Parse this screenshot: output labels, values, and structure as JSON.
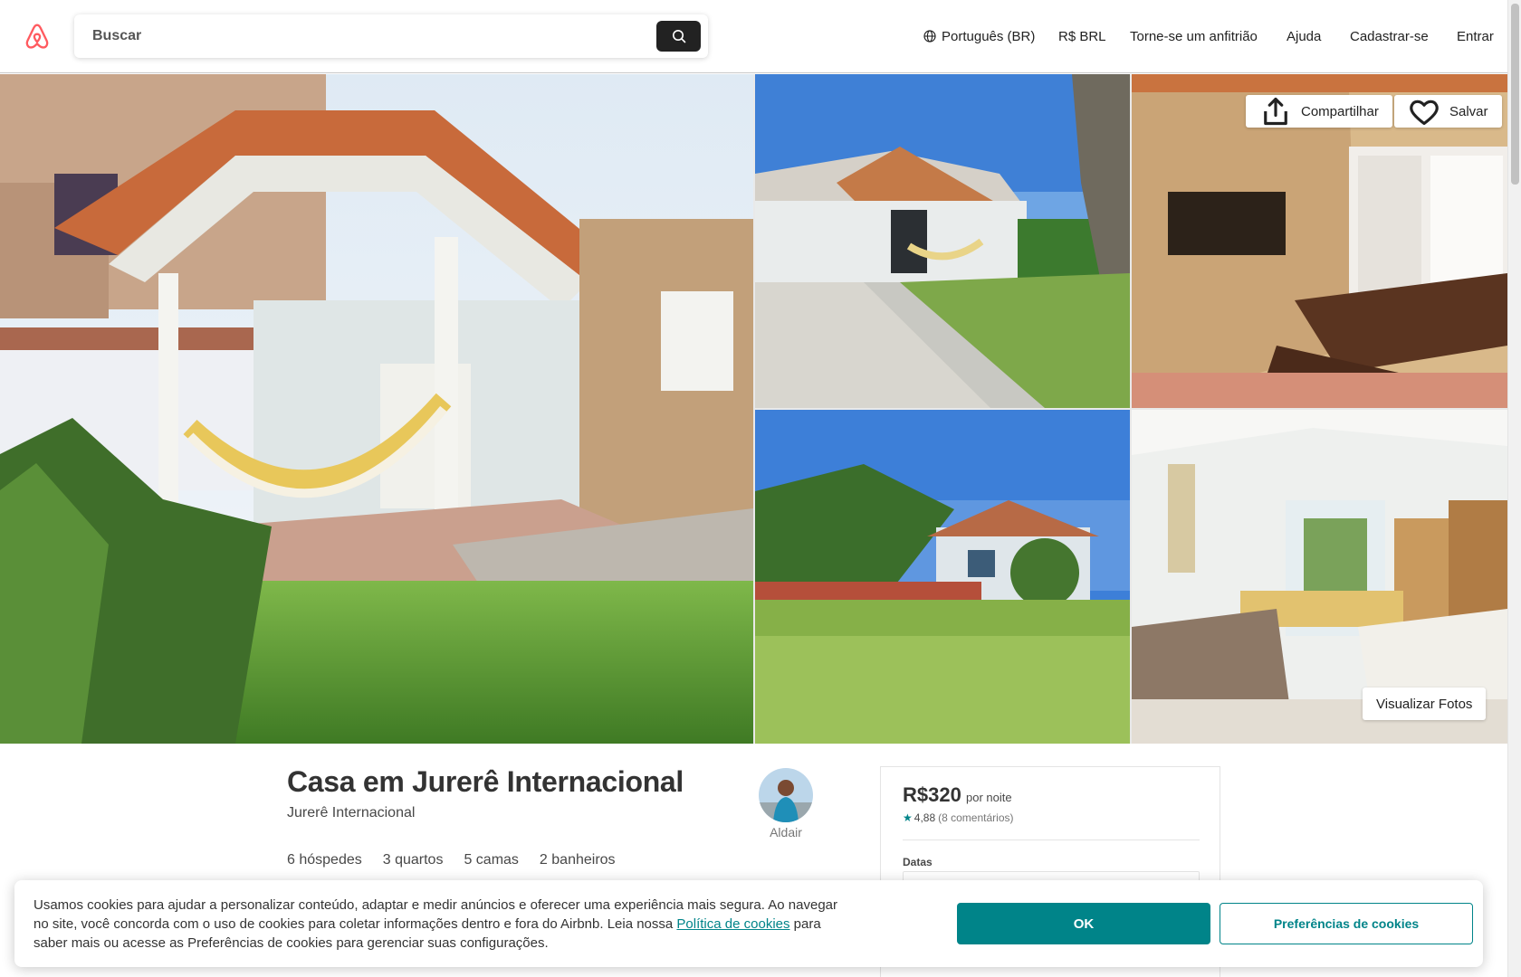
{
  "header": {
    "logo_icon": "airbnb-belo-icon",
    "search_placeholder": "Buscar",
    "search_icon": "search-icon",
    "nav": {
      "language": "Português (BR)",
      "currency": "R$ BRL",
      "host": "Torne-se um anfitrião",
      "help": "Ajuda",
      "signup": "Cadastrar-se",
      "login": "Entrar"
    }
  },
  "photos": {
    "share_label": "Compartilhar",
    "save_label": "Salvar",
    "view_photos_label": "Visualizar Fotos"
  },
  "listing": {
    "title": "Casa em Jurerê Internacional",
    "location": "Jurerê Internacional",
    "host_name": "Aldair",
    "facts": {
      "guests": "6 hóspedes",
      "bedrooms": "3 quartos",
      "beds": "5 camas",
      "bathrooms": "2 banheiros"
    }
  },
  "booking": {
    "price": "R$320",
    "per_night": "por noite",
    "rating": "4,88",
    "reviews": "(8 comentários)",
    "dates_label": "Datas"
  },
  "cookie_banner": {
    "text_before_link": "Usamos cookies para ajudar a personalizar conteúdo, adaptar e medir anúncios e oferecer uma experiência mais segura. Ao navegar no site, você concorda com o uso de cookies para coletar informações dentro e fora do Airbnb. Leia nossa ",
    "link_label": "Política de cookies",
    "text_after_link": " para saber mais ou acesse as Preferências de cookies para gerenciar suas configurações.",
    "ok_label": "OK",
    "preferences_label": "Preferências de cookies"
  },
  "colors": {
    "brand": "#FF5A5F",
    "accent": "#008489",
    "text": "#222222"
  }
}
